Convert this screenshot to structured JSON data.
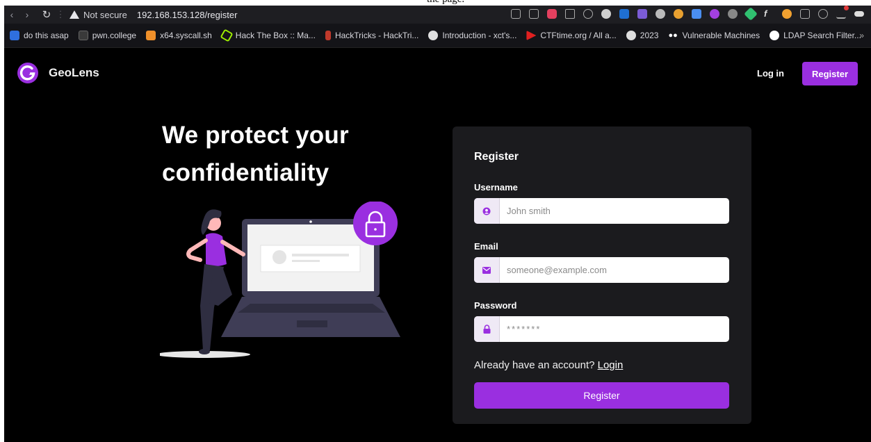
{
  "caption": {
    "text": "the page."
  },
  "browser": {
    "security_label": "Not secure",
    "url": "192.168.153.128/register",
    "bookmarks": [
      {
        "label": "do this asap",
        "color": "#2f6fde"
      },
      {
        "label": "pwn.college",
        "color": "#3a3a3a"
      },
      {
        "label": "x64.syscall.sh",
        "color": "#f0902a"
      },
      {
        "label": "Hack The Box :: Ma...",
        "color": "#9fef00"
      },
      {
        "label": "HackTricks - HackTri...",
        "color": "#c0392b"
      },
      {
        "label": "Introduction - xct's...",
        "color": "#e0e0e0"
      },
      {
        "label": "CTFtime.org / All a...",
        "color": "#e02020"
      },
      {
        "label": "2023",
        "color": "#dddddd"
      },
      {
        "label": "Vulnerable Machines",
        "color": "#ffffff"
      },
      {
        "label": "LDAP Search Filter...",
        "color": "#ffffff"
      }
    ],
    "bookmarks_more": "»"
  },
  "site": {
    "brand": "GeoLens",
    "nav_login": "Log in",
    "nav_register": "Register",
    "accent_color": "#9a2fe0"
  },
  "hero": {
    "line1": "We protect your",
    "line2": "confidentiality"
  },
  "form": {
    "title": "Register",
    "username_label": "Username",
    "username_placeholder": "John smith",
    "email_label": "Email",
    "email_placeholder": "someone@example.com",
    "password_label": "Password",
    "password_placeholder": "*******",
    "already_text": "Already have an account?",
    "login_link": "Login",
    "submit_label": "Register"
  }
}
